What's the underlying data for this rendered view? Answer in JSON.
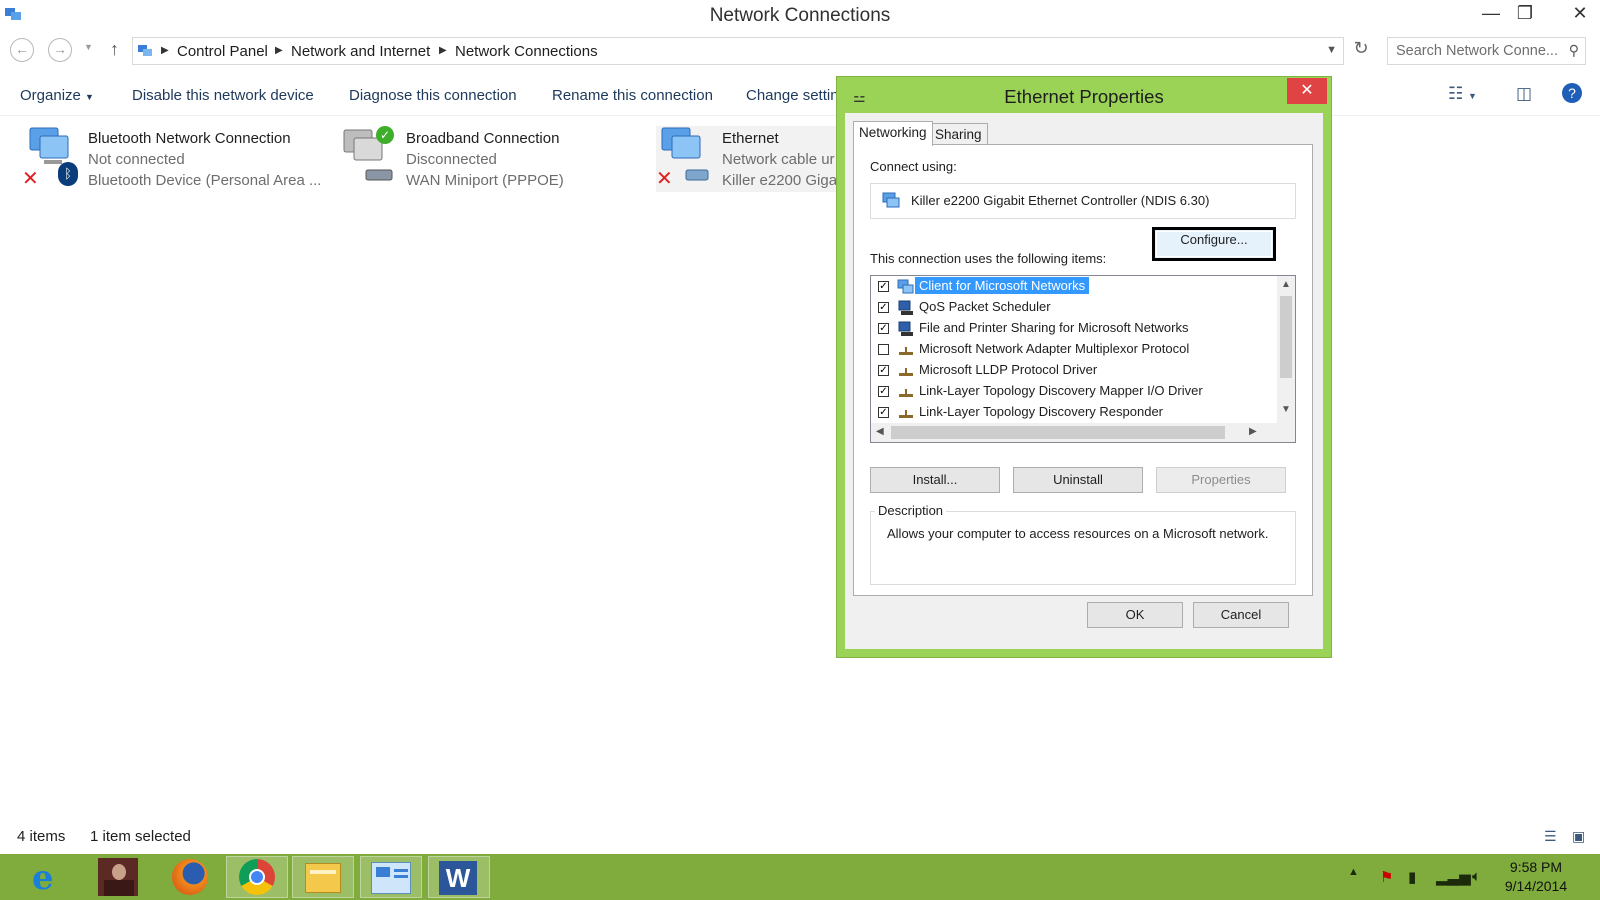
{
  "window": {
    "title": "Network Connections",
    "controls": {
      "minimize": "—",
      "maximize": "❐",
      "close": "✕"
    }
  },
  "address": {
    "crumbs": [
      "Control Panel",
      "Network and Internet",
      "Network Connections"
    ],
    "search_placeholder": "Search Network Conne..."
  },
  "toolbar": {
    "organize": "Organize",
    "commands": [
      "Disable this network device",
      "Diagnose this connection",
      "Rename this connection",
      "Change settin"
    ]
  },
  "connections": [
    {
      "name": "Bluetooth Network Connection",
      "status": "Not connected",
      "device": "Bluetooth Device (Personal Area ...",
      "status_icon": "red-x-icon",
      "selected": false
    },
    {
      "name": "Broadband Connection",
      "status": "Disconnected",
      "device": "WAN Miniport (PPPOE)",
      "status_icon": "green-check-icon",
      "selected": false
    },
    {
      "name": "Ethernet",
      "status": "Network cable ur",
      "device": "Killer e2200 Giga",
      "status_icon": "red-x-icon",
      "selected": true
    }
  ],
  "statusbar": {
    "count": "4 items",
    "selection": "1 item selected"
  },
  "dialog": {
    "title": "Ethernet Properties",
    "tabs": [
      "Networking",
      "Sharing"
    ],
    "connect_using_label": "Connect using:",
    "adapter": "Killer e2200 Gigabit Ethernet Controller (NDIS 6.30)",
    "configure": "Configure...",
    "items_label": "This connection uses the following items:",
    "items": [
      {
        "label": "Client for Microsoft Networks",
        "checked": true,
        "selected": true
      },
      {
        "label": "QoS Packet Scheduler",
        "checked": true,
        "selected": false
      },
      {
        "label": "File and Printer Sharing for Microsoft Networks",
        "checked": true,
        "selected": false
      },
      {
        "label": "Microsoft Network Adapter Multiplexor Protocol",
        "checked": false,
        "selected": false
      },
      {
        "label": "Microsoft LLDP Protocol Driver",
        "checked": true,
        "selected": false
      },
      {
        "label": "Link-Layer Topology Discovery Mapper I/O Driver",
        "checked": true,
        "selected": false
      },
      {
        "label": "Link-Layer Topology Discovery Responder",
        "checked": true,
        "selected": false
      }
    ],
    "install": "Install...",
    "uninstall": "Uninstall",
    "properties": "Properties",
    "description_label": "Description",
    "description": "Allows your computer to access resources on a Microsoft network.",
    "ok": "OK",
    "cancel": "Cancel"
  },
  "taskbar": {
    "apps": [
      "internet-explorer-icon",
      "user-photo-icon",
      "firefox-icon",
      "chrome-icon",
      "file-explorer-icon",
      "control-panel-icon",
      "word-icon"
    ],
    "time": "9:58 PM",
    "date": "9/14/2014"
  },
  "colors": {
    "accent": "#9bd356",
    "taskbar": "#7fac3d",
    "selection": "#3399ff",
    "close": "#e04343"
  }
}
